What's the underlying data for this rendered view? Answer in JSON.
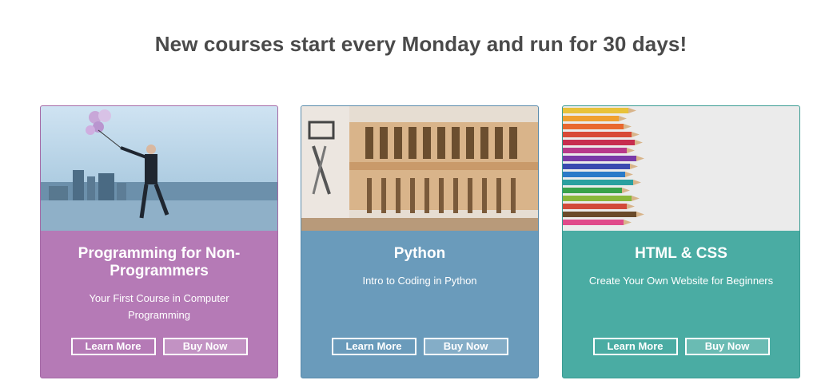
{
  "headline": "New courses start every Monday and run for 30 days!",
  "courses": [
    {
      "title": "Programming for Non-Programmers",
      "subtitle": "Your First Course in Computer Programming",
      "image": "man-with-balloons-image",
      "accent": "#b57ab6",
      "learn_more": "Learn More",
      "buy_now": "Buy Now"
    },
    {
      "title": "Python",
      "subtitle": "Intro to Coding in Python",
      "image": "tool-wall-image",
      "accent": "#6a9bbb",
      "learn_more": "Learn More",
      "buy_now": "Buy Now"
    },
    {
      "title": "HTML & CSS",
      "subtitle": "Create Your Own Website for Beginners",
      "image": "colored-pencils-image",
      "accent": "#4aaca3",
      "learn_more": "Learn More",
      "buy_now": "Buy Now"
    }
  ]
}
